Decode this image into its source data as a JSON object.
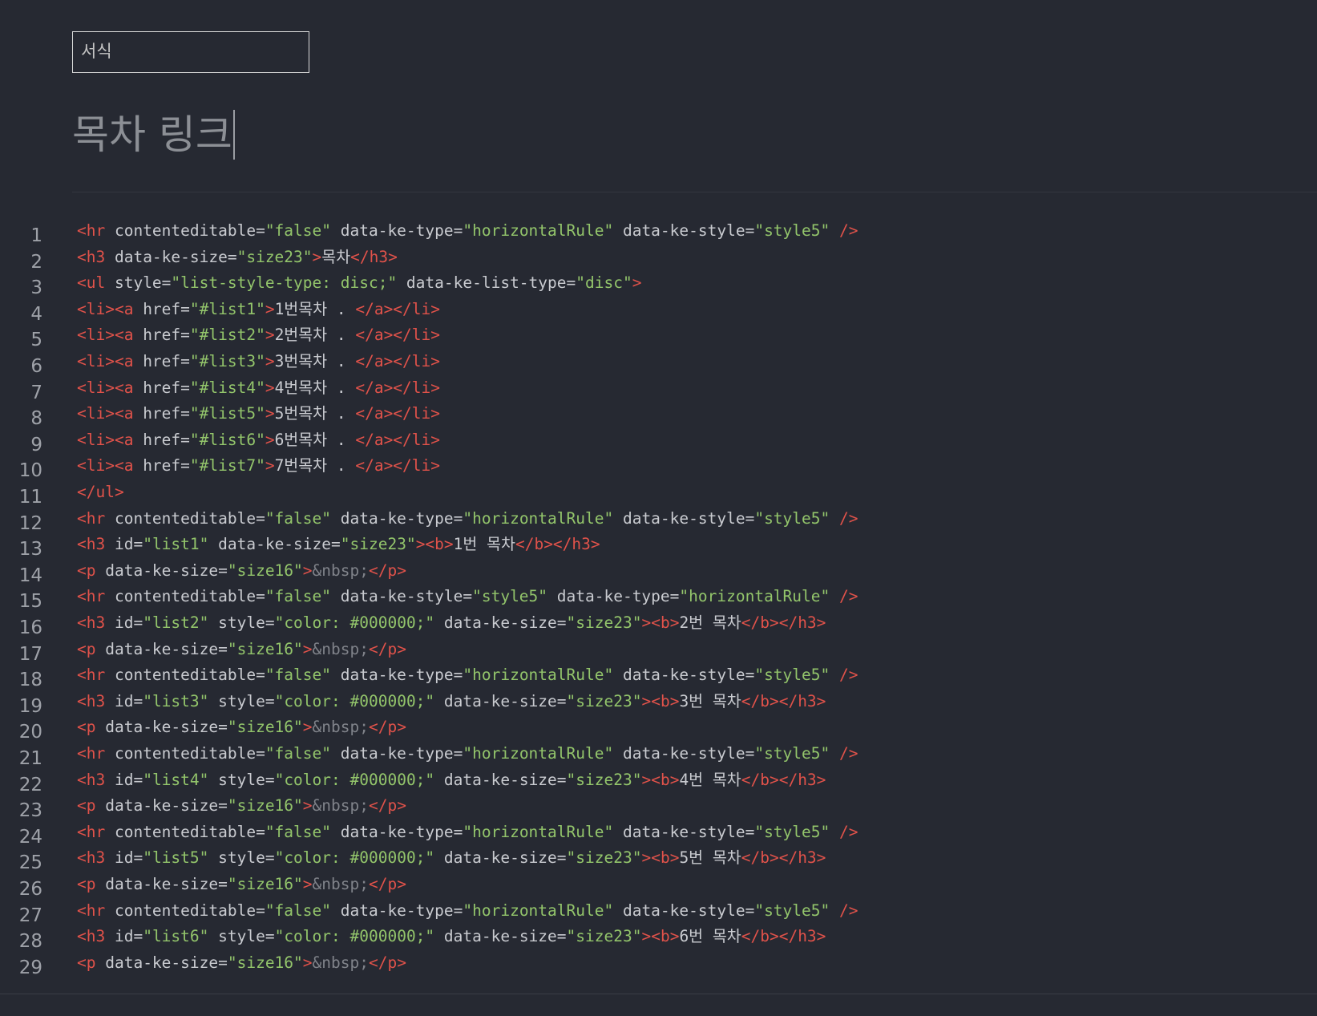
{
  "format_select": {
    "label": "서식"
  },
  "document": {
    "title": "목차 링크"
  },
  "editor": {
    "colors": {
      "background": "#262932",
      "tag": "#e0524a",
      "attribute": "#c9cbd0",
      "string": "#93c56b",
      "text": "#c9cbd0",
      "entity": "#80838a",
      "line_number": "#9ea1a8"
    },
    "lines": [
      [
        [
          "tag",
          "<hr "
        ],
        [
          "attr",
          "contenteditable="
        ],
        [
          "str",
          "\"false\""
        ],
        [
          "attr",
          " data-ke-type="
        ],
        [
          "str",
          "\"horizontalRule\""
        ],
        [
          "attr",
          " data-ke-style="
        ],
        [
          "str",
          "\"style5\""
        ],
        [
          "tag",
          " />"
        ]
      ],
      [
        [
          "tag",
          "<h3 "
        ],
        [
          "attr",
          "data-ke-size="
        ],
        [
          "str",
          "\"size23\""
        ],
        [
          "tag",
          ">"
        ],
        [
          "text",
          "목차"
        ],
        [
          "tag",
          "</h3>"
        ]
      ],
      [
        [
          "tag",
          "<ul "
        ],
        [
          "attr",
          "style="
        ],
        [
          "str",
          "\"list-style-type: disc;\""
        ],
        [
          "attr",
          " data-ke-list-type="
        ],
        [
          "str",
          "\"disc\""
        ],
        [
          "tag",
          ">"
        ]
      ],
      [
        [
          "tag",
          "<li><a "
        ],
        [
          "attr",
          "href="
        ],
        [
          "str",
          "\"#list1\""
        ],
        [
          "tag",
          ">"
        ],
        [
          "text",
          "1번목차 . "
        ],
        [
          "tag",
          "</a></li>"
        ]
      ],
      [
        [
          "tag",
          "<li><a "
        ],
        [
          "attr",
          "href="
        ],
        [
          "str",
          "\"#list2\""
        ],
        [
          "tag",
          ">"
        ],
        [
          "text",
          "2번목차 . "
        ],
        [
          "tag",
          "</a></li>"
        ]
      ],
      [
        [
          "tag",
          "<li><a "
        ],
        [
          "attr",
          "href="
        ],
        [
          "str",
          "\"#list3\""
        ],
        [
          "tag",
          ">"
        ],
        [
          "text",
          "3번목차 . "
        ],
        [
          "tag",
          "</a></li>"
        ]
      ],
      [
        [
          "tag",
          "<li><a "
        ],
        [
          "attr",
          "href="
        ],
        [
          "str",
          "\"#list4\""
        ],
        [
          "tag",
          ">"
        ],
        [
          "text",
          "4번목차 . "
        ],
        [
          "tag",
          "</a></li>"
        ]
      ],
      [
        [
          "tag",
          "<li><a "
        ],
        [
          "attr",
          "href="
        ],
        [
          "str",
          "\"#list5\""
        ],
        [
          "tag",
          ">"
        ],
        [
          "text",
          "5번목차 . "
        ],
        [
          "tag",
          "</a></li>"
        ]
      ],
      [
        [
          "tag",
          "<li><a "
        ],
        [
          "attr",
          "href="
        ],
        [
          "str",
          "\"#list6\""
        ],
        [
          "tag",
          ">"
        ],
        [
          "text",
          "6번목차 . "
        ],
        [
          "tag",
          "</a></li>"
        ]
      ],
      [
        [
          "tag",
          "<li><a "
        ],
        [
          "attr",
          "href="
        ],
        [
          "str",
          "\"#list7\""
        ],
        [
          "tag",
          ">"
        ],
        [
          "text",
          "7번목차 . "
        ],
        [
          "tag",
          "</a></li>"
        ]
      ],
      [
        [
          "tag",
          "</ul>"
        ]
      ],
      [
        [
          "tag",
          "<hr "
        ],
        [
          "attr",
          "contenteditable="
        ],
        [
          "str",
          "\"false\""
        ],
        [
          "attr",
          " data-ke-type="
        ],
        [
          "str",
          "\"horizontalRule\""
        ],
        [
          "attr",
          " data-ke-style="
        ],
        [
          "str",
          "\"style5\""
        ],
        [
          "tag",
          " />"
        ]
      ],
      [
        [
          "tag",
          "<h3 "
        ],
        [
          "attr",
          "id="
        ],
        [
          "str",
          "\"list1\""
        ],
        [
          "attr",
          " data-ke-size="
        ],
        [
          "str",
          "\"size23\""
        ],
        [
          "tag",
          "><b>"
        ],
        [
          "text",
          "1번 목차"
        ],
        [
          "tag",
          "</b></h3>"
        ]
      ],
      [
        [
          "tag",
          "<p "
        ],
        [
          "attr",
          "data-ke-size="
        ],
        [
          "str",
          "\"size16\""
        ],
        [
          "tag",
          ">"
        ],
        [
          "ent",
          "&nbsp;"
        ],
        [
          "tag",
          "</p>"
        ]
      ],
      [
        [
          "tag",
          "<hr "
        ],
        [
          "attr",
          "contenteditable="
        ],
        [
          "str",
          "\"false\""
        ],
        [
          "attr",
          " data-ke-style="
        ],
        [
          "str",
          "\"style5\""
        ],
        [
          "attr",
          " data-ke-type="
        ],
        [
          "str",
          "\"horizontalRule\""
        ],
        [
          "tag",
          " />"
        ]
      ],
      [
        [
          "tag",
          "<h3 "
        ],
        [
          "attr",
          "id="
        ],
        [
          "str",
          "\"list2\""
        ],
        [
          "attr",
          " style="
        ],
        [
          "str",
          "\"color: #000000;\""
        ],
        [
          "attr",
          " data-ke-size="
        ],
        [
          "str",
          "\"size23\""
        ],
        [
          "tag",
          "><b>"
        ],
        [
          "text",
          "2번 목차"
        ],
        [
          "tag",
          "</b></h3>"
        ]
      ],
      [
        [
          "tag",
          "<p "
        ],
        [
          "attr",
          "data-ke-size="
        ],
        [
          "str",
          "\"size16\""
        ],
        [
          "tag",
          ">"
        ],
        [
          "ent",
          "&nbsp;"
        ],
        [
          "tag",
          "</p>"
        ]
      ],
      [
        [
          "tag",
          "<hr "
        ],
        [
          "attr",
          "contenteditable="
        ],
        [
          "str",
          "\"false\""
        ],
        [
          "attr",
          " data-ke-type="
        ],
        [
          "str",
          "\"horizontalRule\""
        ],
        [
          "attr",
          " data-ke-style="
        ],
        [
          "str",
          "\"style5\""
        ],
        [
          "tag",
          " />"
        ]
      ],
      [
        [
          "tag",
          "<h3 "
        ],
        [
          "attr",
          "id="
        ],
        [
          "str",
          "\"list3\""
        ],
        [
          "attr",
          " style="
        ],
        [
          "str",
          "\"color: #000000;\""
        ],
        [
          "attr",
          " data-ke-size="
        ],
        [
          "str",
          "\"size23\""
        ],
        [
          "tag",
          "><b>"
        ],
        [
          "text",
          "3번 목차"
        ],
        [
          "tag",
          "</b></h3>"
        ]
      ],
      [
        [
          "tag",
          "<p "
        ],
        [
          "attr",
          "data-ke-size="
        ],
        [
          "str",
          "\"size16\""
        ],
        [
          "tag",
          ">"
        ],
        [
          "ent",
          "&nbsp;"
        ],
        [
          "tag",
          "</p>"
        ]
      ],
      [
        [
          "tag",
          "<hr "
        ],
        [
          "attr",
          "contenteditable="
        ],
        [
          "str",
          "\"false\""
        ],
        [
          "attr",
          " data-ke-type="
        ],
        [
          "str",
          "\"horizontalRule\""
        ],
        [
          "attr",
          " data-ke-style="
        ],
        [
          "str",
          "\"style5\""
        ],
        [
          "tag",
          " />"
        ]
      ],
      [
        [
          "tag",
          "<h3 "
        ],
        [
          "attr",
          "id="
        ],
        [
          "str",
          "\"list4\""
        ],
        [
          "attr",
          " style="
        ],
        [
          "str",
          "\"color: #000000;\""
        ],
        [
          "attr",
          " data-ke-size="
        ],
        [
          "str",
          "\"size23\""
        ],
        [
          "tag",
          "><b>"
        ],
        [
          "text",
          "4번 목차"
        ],
        [
          "tag",
          "</b></h3>"
        ]
      ],
      [
        [
          "tag",
          "<p "
        ],
        [
          "attr",
          "data-ke-size="
        ],
        [
          "str",
          "\"size16\""
        ],
        [
          "tag",
          ">"
        ],
        [
          "ent",
          "&nbsp;"
        ],
        [
          "tag",
          "</p>"
        ]
      ],
      [
        [
          "tag",
          "<hr "
        ],
        [
          "attr",
          "contenteditable="
        ],
        [
          "str",
          "\"false\""
        ],
        [
          "attr",
          " data-ke-type="
        ],
        [
          "str",
          "\"horizontalRule\""
        ],
        [
          "attr",
          " data-ke-style="
        ],
        [
          "str",
          "\"style5\""
        ],
        [
          "tag",
          " />"
        ]
      ],
      [
        [
          "tag",
          "<h3 "
        ],
        [
          "attr",
          "id="
        ],
        [
          "str",
          "\"list5\""
        ],
        [
          "attr",
          " style="
        ],
        [
          "str",
          "\"color: #000000;\""
        ],
        [
          "attr",
          " data-ke-size="
        ],
        [
          "str",
          "\"size23\""
        ],
        [
          "tag",
          "><b>"
        ],
        [
          "text",
          "5번 목차"
        ],
        [
          "tag",
          "</b></h3>"
        ]
      ],
      [
        [
          "tag",
          "<p "
        ],
        [
          "attr",
          "data-ke-size="
        ],
        [
          "str",
          "\"size16\""
        ],
        [
          "tag",
          ">"
        ],
        [
          "ent",
          "&nbsp;"
        ],
        [
          "tag",
          "</p>"
        ]
      ],
      [
        [
          "tag",
          "<hr "
        ],
        [
          "attr",
          "contenteditable="
        ],
        [
          "str",
          "\"false\""
        ],
        [
          "attr",
          " data-ke-type="
        ],
        [
          "str",
          "\"horizontalRule\""
        ],
        [
          "attr",
          " data-ke-style="
        ],
        [
          "str",
          "\"style5\""
        ],
        [
          "tag",
          " />"
        ]
      ],
      [
        [
          "tag",
          "<h3 "
        ],
        [
          "attr",
          "id="
        ],
        [
          "str",
          "\"list6\""
        ],
        [
          "attr",
          " style="
        ],
        [
          "str",
          "\"color: #000000;\""
        ],
        [
          "attr",
          " data-ke-size="
        ],
        [
          "str",
          "\"size23\""
        ],
        [
          "tag",
          "><b>"
        ],
        [
          "text",
          "6번 목차"
        ],
        [
          "tag",
          "</b></h3>"
        ]
      ],
      [
        [
          "tag",
          "<p "
        ],
        [
          "attr",
          "data-ke-size="
        ],
        [
          "str",
          "\"size16\""
        ],
        [
          "tag",
          ">"
        ],
        [
          "ent",
          "&nbsp;"
        ],
        [
          "tag",
          "</p>"
        ]
      ]
    ]
  }
}
